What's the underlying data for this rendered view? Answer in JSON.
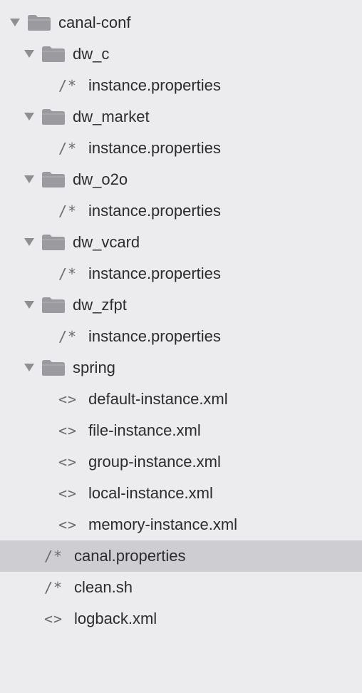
{
  "file_tree": {
    "root": {
      "label": "canal-conf",
      "icon": "folder-icon",
      "expanded": true
    },
    "folders": [
      {
        "label": "dw_c",
        "expanded": true,
        "files": [
          {
            "label": "instance.properties",
            "icon": "properties-file-icon",
            "glyph": "/*"
          }
        ]
      },
      {
        "label": "dw_market",
        "expanded": true,
        "files": [
          {
            "label": "instance.properties",
            "icon": "properties-file-icon",
            "glyph": "/*"
          }
        ]
      },
      {
        "label": "dw_o2o",
        "expanded": true,
        "files": [
          {
            "label": "instance.properties",
            "icon": "properties-file-icon",
            "glyph": "/*"
          }
        ]
      },
      {
        "label": "dw_vcard",
        "expanded": true,
        "files": [
          {
            "label": "instance.properties",
            "icon": "properties-file-icon",
            "glyph": "/*"
          }
        ]
      },
      {
        "label": "dw_zfpt",
        "expanded": true,
        "files": [
          {
            "label": "instance.properties",
            "icon": "properties-file-icon",
            "glyph": "/*"
          }
        ]
      },
      {
        "label": "spring",
        "expanded": true,
        "files": [
          {
            "label": "default-instance.xml",
            "icon": "xml-file-icon",
            "glyph": "<>"
          },
          {
            "label": "file-instance.xml",
            "icon": "xml-file-icon",
            "glyph": "<>"
          },
          {
            "label": "group-instance.xml",
            "icon": "xml-file-icon",
            "glyph": "<>"
          },
          {
            "label": "local-instance.xml",
            "icon": "xml-file-icon",
            "glyph": "<>"
          },
          {
            "label": "memory-instance.xml",
            "icon": "xml-file-icon",
            "glyph": "<>"
          }
        ]
      }
    ],
    "root_files": [
      {
        "label": "canal.properties",
        "icon": "properties-file-icon",
        "glyph": "/*",
        "selected": true
      },
      {
        "label": "clean.sh",
        "icon": "shell-file-icon",
        "glyph": "/*",
        "selected": false
      },
      {
        "label": "logback.xml",
        "icon": "xml-file-icon",
        "glyph": "<>",
        "selected": false
      }
    ]
  },
  "colors": {
    "background": "#ececee",
    "selection": "#cdcdd2",
    "folder": "#9a9a9f",
    "text": "#2c2c2e",
    "icon_glyph": "#6b6b70"
  }
}
